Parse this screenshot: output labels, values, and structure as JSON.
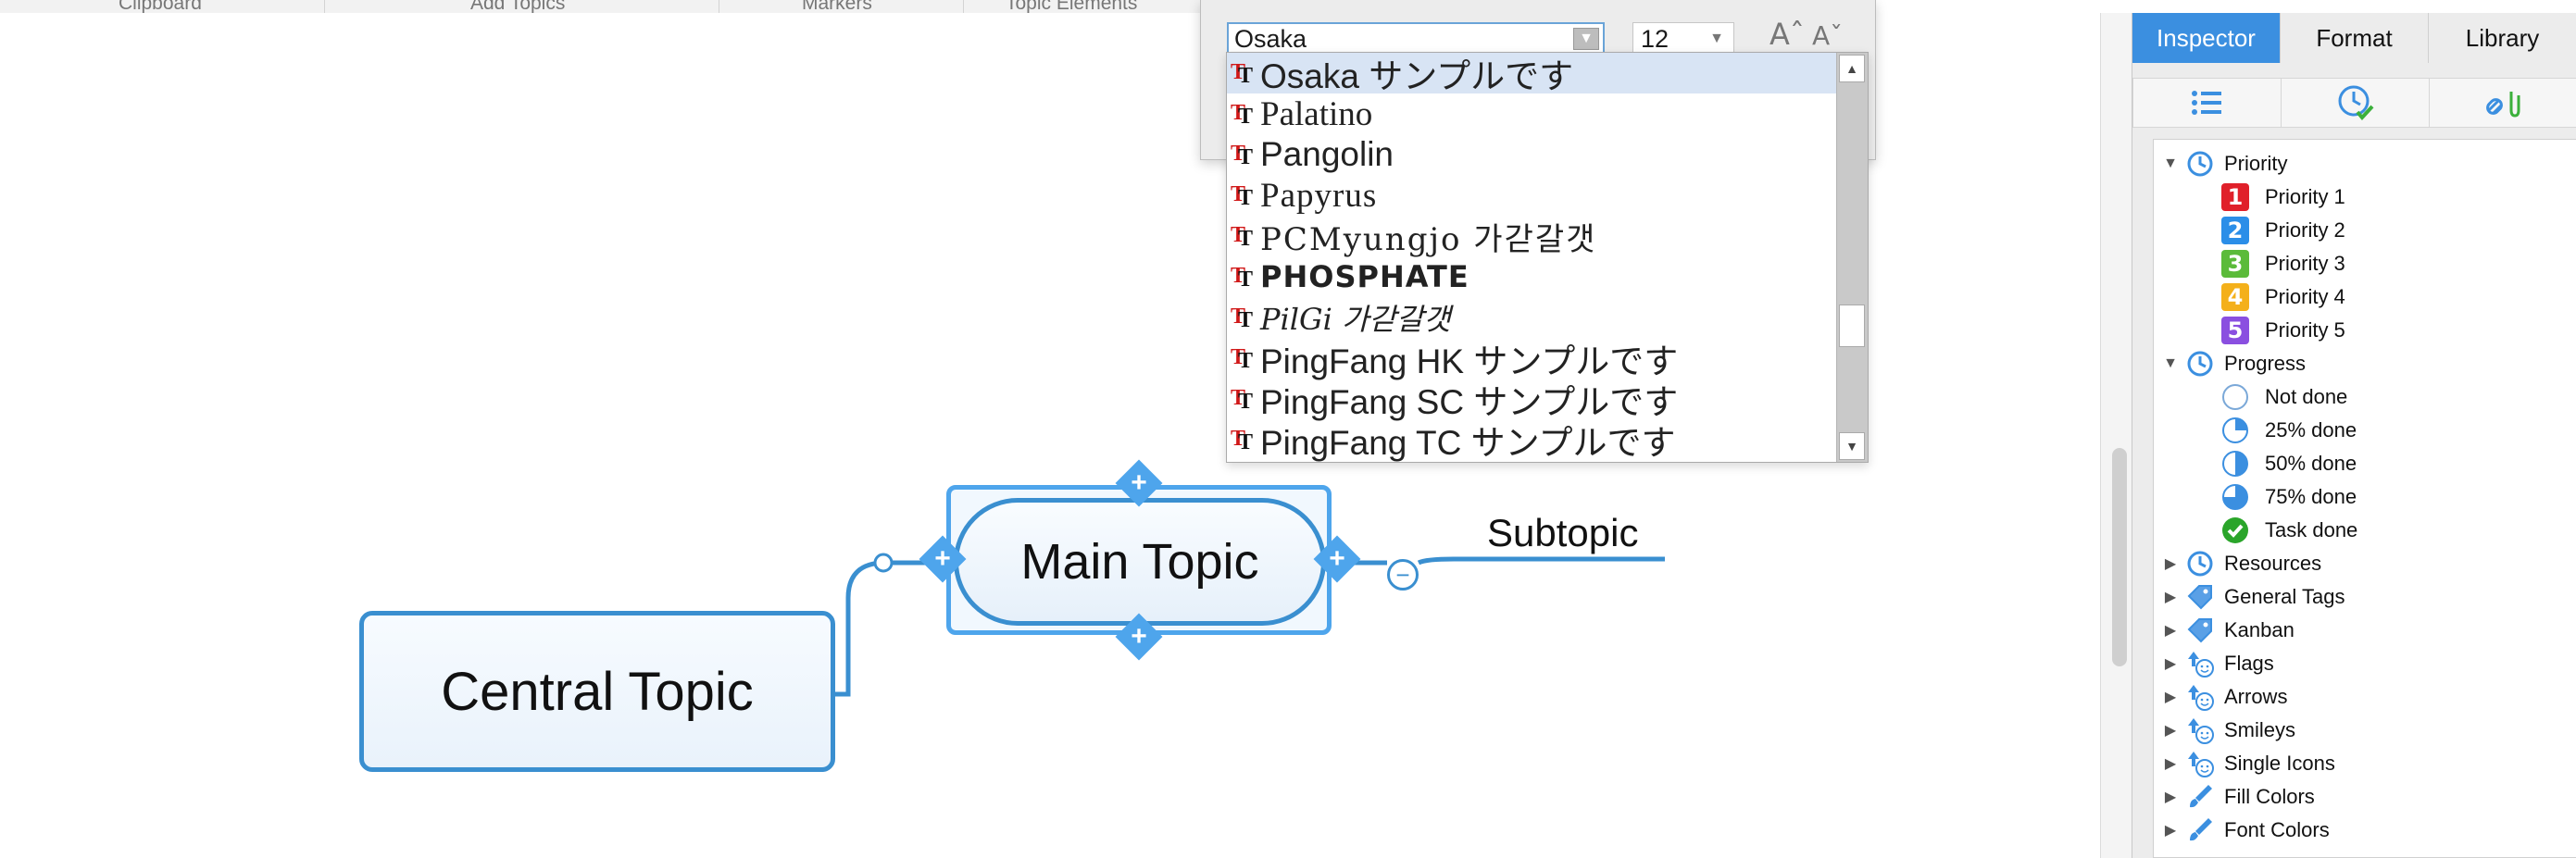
{
  "ribbon": {
    "groups": [
      "Clipboard",
      "Add Topics",
      "Markers",
      "Topic Elements"
    ]
  },
  "font_popover": {
    "font_value": "Osaka",
    "size_value": "12",
    "grow_label": "Aˆ",
    "shrink_label": "Aˇ",
    "fonts": [
      {
        "name": "Osaka  サンプルです",
        "selected": true
      },
      {
        "name": "Palatino",
        "selected": false
      },
      {
        "name": "Pangolin",
        "selected": false
      },
      {
        "name": "Papyrus",
        "selected": false
      },
      {
        "name": "PCMyungjo  가갇갈갯",
        "selected": false
      },
      {
        "name": "PHOSPHATE",
        "selected": false
      },
      {
        "name": "PilGi  가갇갈갯",
        "selected": false
      },
      {
        "name": "PingFang HK  サンプルです",
        "selected": false
      },
      {
        "name": "PingFang SC  サンプルです",
        "selected": false
      },
      {
        "name": "PingFang TC  サンプルです",
        "selected": false
      }
    ]
  },
  "canvas": {
    "central_topic": "Central Topic",
    "main_topic": "Main Topic",
    "subtopic": "Subtopic",
    "handle_symbol": "+",
    "collapse_symbol": "−"
  },
  "inspector": {
    "tabs": [
      "Inspector",
      "Format",
      "Library"
    ],
    "active_tab": "Inspector",
    "subtab_icons": [
      "list-icon",
      "clock-check-icon",
      "link-attachment-icon"
    ],
    "groups": {
      "priority": {
        "label": "Priority",
        "items": [
          {
            "label": "Priority 1",
            "num": "1",
            "color": "#e0202a"
          },
          {
            "label": "Priority 2",
            "num": "2",
            "color": "#2b8ee8"
          },
          {
            "label": "Priority 3",
            "num": "3",
            "color": "#5bbb3a"
          },
          {
            "label": "Priority 4",
            "num": "4",
            "color": "#f4b01a"
          },
          {
            "label": "Priority 5",
            "num": "5",
            "color": "#8a4fe0"
          }
        ]
      },
      "progress": {
        "label": "Progress",
        "items": [
          {
            "label": "Not done",
            "fraction": 0
          },
          {
            "label": "25% done",
            "fraction": 0.25
          },
          {
            "label": "50% done",
            "fraction": 0.5
          },
          {
            "label": "75% done",
            "fraction": 0.75
          },
          {
            "label": "Task done",
            "fraction": 1
          }
        ]
      },
      "collapsed": [
        {
          "label": "Resources",
          "icon": "clock-icon"
        },
        {
          "label": "General Tags",
          "icon": "tag-icon"
        },
        {
          "label": "Kanban",
          "icon": "tag-icon"
        },
        {
          "label": "Flags",
          "icon": "smiley-arrow-icon"
        },
        {
          "label": "Arrows",
          "icon": "smiley-arrow-icon"
        },
        {
          "label": "Smileys",
          "icon": "smiley-arrow-icon"
        },
        {
          "label": "Single Icons",
          "icon": "smiley-arrow-icon"
        },
        {
          "label": "Fill Colors",
          "icon": "paintbrush-icon"
        },
        {
          "label": "Font Colors",
          "icon": "paintbrush-icon"
        }
      ]
    }
  },
  "colors": {
    "accent": "#3b8fe0",
    "topic_border": "#3a8fd0",
    "selection": "#4ea5ec"
  }
}
